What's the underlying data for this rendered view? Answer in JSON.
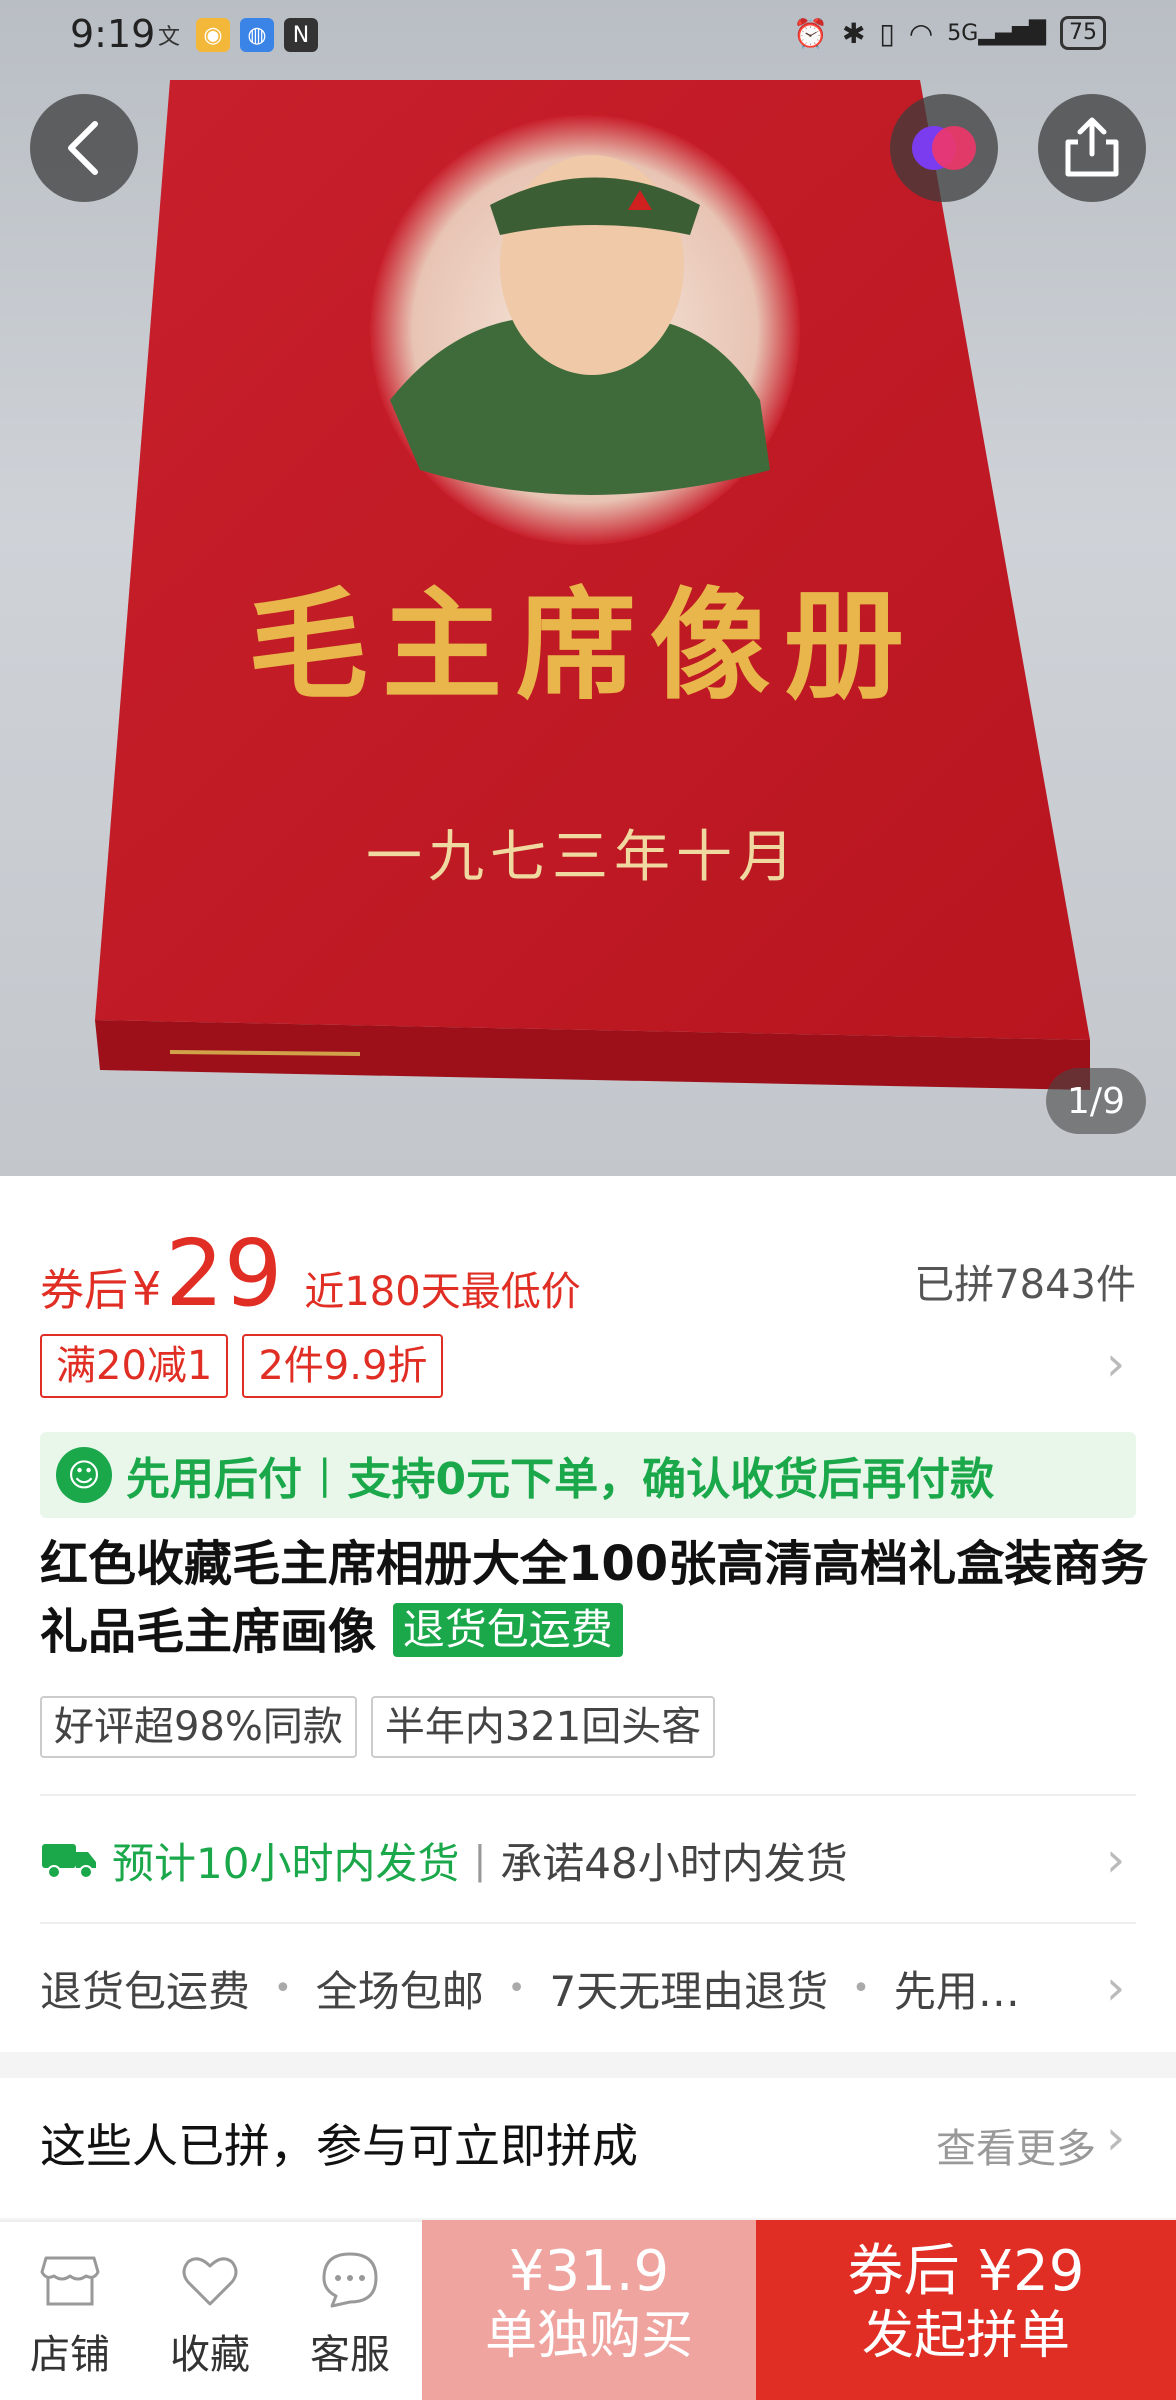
{
  "status_bar": {
    "time": "9:19",
    "battery": "75",
    "network": "5G"
  },
  "gallery": {
    "counter": "1/9",
    "album_title": "毛主席像册",
    "album_date": "一九七三年十月"
  },
  "price": {
    "label": "券后",
    "currency": "¥",
    "amount": "29",
    "lowest_note": "近180天最低价",
    "sold": "已拼7843件"
  },
  "promo_tags": [
    "满20减1",
    "2件9.9折"
  ],
  "pay_later": {
    "title": "先用后付",
    "desc": "支持0元下单，确认收货后再付款"
  },
  "product": {
    "title": "红色收藏毛主席相册大全100张高清高档礼盒装商务礼品毛主席画像",
    "badge": "退货包运费"
  },
  "review_tags": [
    "好评超98%同款",
    "半年内321回头客"
  ],
  "shipping": {
    "estimate": "预计10小时内发货",
    "promise": "承诺48小时内发货"
  },
  "services": [
    "退货包运费",
    "全场包邮",
    "7天无理由退货",
    "先用…"
  ],
  "group": {
    "title": "这些人已拼，参与可立即拼成",
    "more": "查看更多"
  },
  "bottom_bar": {
    "shop": "店铺",
    "favorite": "收藏",
    "service": "客服",
    "single_price": "¥31.9",
    "single_label": "单独购买",
    "group_price": "券后 ¥29",
    "group_label": "发起拼单"
  },
  "colors": {
    "accent_red": "#e02e24",
    "green": "#1aa84b",
    "single_btn": "#f0a4a0"
  }
}
